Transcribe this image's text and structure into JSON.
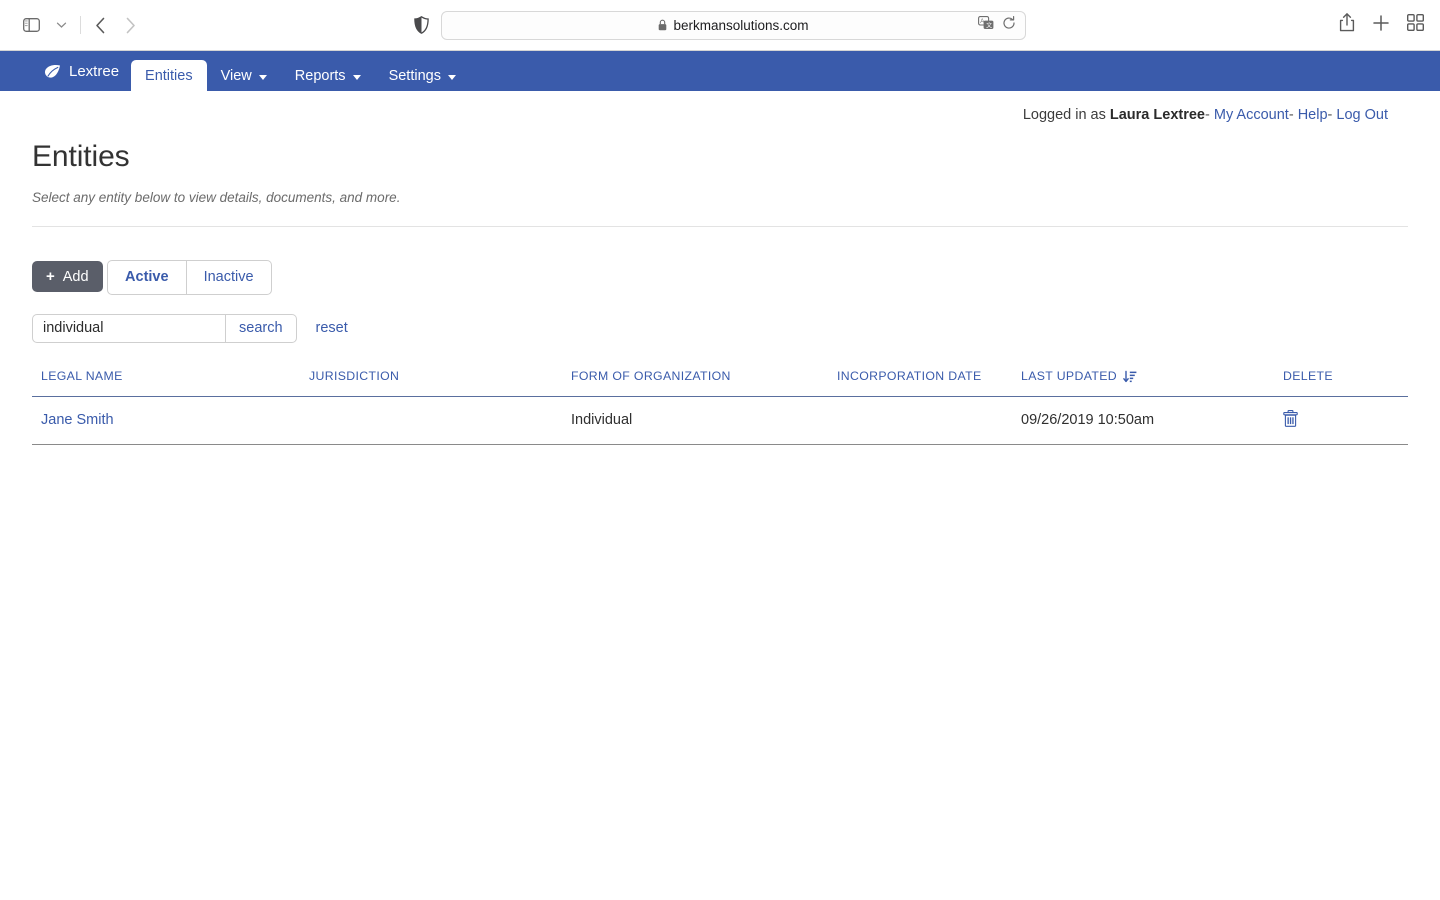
{
  "browser": {
    "url": "berkmansolutions.com",
    "icons": {
      "sidebar": "sidebar-toggle-icon",
      "chevron": "chevron-down-icon",
      "back": "back-arrow-icon",
      "forward": "forward-arrow-icon",
      "shield": "privacy-shield-icon",
      "lock": "lock-icon",
      "translate": "translate-icon",
      "reload": "reload-icon",
      "share": "share-icon",
      "newtab": "plus-icon",
      "tabs": "tab-overview-icon"
    }
  },
  "navbar": {
    "brand": "Lextree",
    "brand_icon": "leaf-icon",
    "items": [
      {
        "label": "Entities",
        "active": true,
        "caret": false
      },
      {
        "label": "View",
        "active": false,
        "caret": true
      },
      {
        "label": "Reports",
        "active": false,
        "caret": true
      },
      {
        "label": "Settings",
        "active": false,
        "caret": true
      }
    ]
  },
  "account_bar": {
    "prefix": "Logged in as",
    "user": "Laura Lextree",
    "separator": "-",
    "links": [
      "My Account",
      "Help",
      "Log Out"
    ]
  },
  "page": {
    "title": "Entities",
    "subtitle": "Select any entity below to view details, documents, and more."
  },
  "toolbar": {
    "add_label": "Add",
    "add_icon": "plus-icon",
    "add_bg": "#5a5e69"
  },
  "filters": {
    "segments": [
      {
        "label": "Active",
        "selected": true
      },
      {
        "label": "Inactive",
        "selected": false
      }
    ]
  },
  "search": {
    "value": "individual",
    "placeholder": "",
    "button_label": "search",
    "reset_label": "reset"
  },
  "table": {
    "columns": [
      {
        "key": "legal_name",
        "label": "LEGAL NAME",
        "sorted": false
      },
      {
        "key": "jurisdiction",
        "label": "JURISDICTION",
        "sorted": false
      },
      {
        "key": "form_of_organization",
        "label": "FORM OF ORGANIZATION",
        "sorted": false
      },
      {
        "key": "incorporation_date",
        "label": "INCORPORATION DATE",
        "sorted": false
      },
      {
        "key": "last_updated",
        "label": "LAST UPDATED",
        "sorted": true,
        "sort_icon": "sort-descending-icon"
      },
      {
        "key": "delete",
        "label": "DELETE",
        "sorted": false
      }
    ],
    "rows": [
      {
        "legal_name": "Jane Smith",
        "jurisdiction": "",
        "form_of_organization": "Individual",
        "incorporation_date": "",
        "last_updated": "09/26/2019 10:50am",
        "delete_icon": "trash-icon"
      }
    ]
  },
  "colors": {
    "nav_blue": "#3a5bab",
    "link_blue": "#3a5bab",
    "add_gray": "#5a5e69"
  }
}
